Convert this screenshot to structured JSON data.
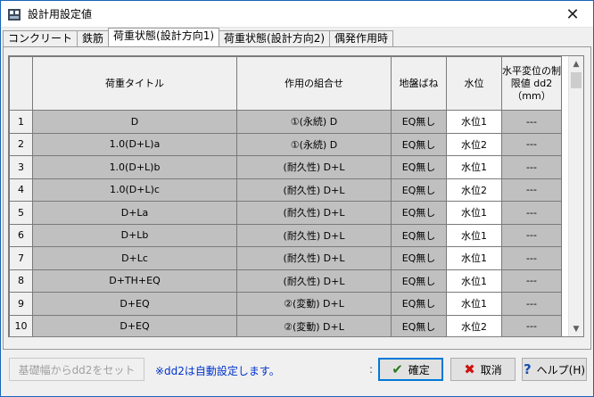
{
  "window": {
    "title": "設計用設定値",
    "close": "✕"
  },
  "tabs": [
    {
      "label": "コンクリート"
    },
    {
      "label": "鉄筋"
    },
    {
      "label": "荷重状態(設計方向1)"
    },
    {
      "label": "荷重状態(設計方向2)"
    },
    {
      "label": "偶発作用時"
    }
  ],
  "table": {
    "headers": [
      "荷重タイトル",
      "作用の組合せ",
      "地盤ばね",
      "水位",
      "水平変位の制限値 dd2（mm）"
    ],
    "rows": [
      {
        "no": "1",
        "title": "D",
        "combo": "①(永続) D",
        "spring": "EQ無し",
        "water": "水位1",
        "limit": "---"
      },
      {
        "no": "2",
        "title": "1.0(D+L)a",
        "combo": "①(永続) D",
        "spring": "EQ無し",
        "water": "水位2",
        "limit": "---"
      },
      {
        "no": "3",
        "title": "1.0(D+L)b",
        "combo": "(耐久性) D+L",
        "spring": "EQ無し",
        "water": "水位1",
        "limit": "---"
      },
      {
        "no": "4",
        "title": "1.0(D+L)c",
        "combo": "(耐久性) D+L",
        "spring": "EQ無し",
        "water": "水位2",
        "limit": "---"
      },
      {
        "no": "5",
        "title": "D+La",
        "combo": "(耐久性) D+L",
        "spring": "EQ無し",
        "water": "水位1",
        "limit": "---"
      },
      {
        "no": "6",
        "title": "D+Lb",
        "combo": "(耐久性) D+L",
        "spring": "EQ無し",
        "water": "水位1",
        "limit": "---"
      },
      {
        "no": "7",
        "title": "D+Lc",
        "combo": "(耐久性) D+L",
        "spring": "EQ無し",
        "water": "水位1",
        "limit": "---"
      },
      {
        "no": "8",
        "title": "D+TH+EQ",
        "combo": "(耐久性) D+L",
        "spring": "EQ無し",
        "water": "水位1",
        "limit": "---"
      },
      {
        "no": "9",
        "title": "D+EQ",
        "combo": "②(変動) D+L",
        "spring": "EQ無し",
        "water": "水位1",
        "limit": "---"
      },
      {
        "no": "10",
        "title": "D+EQ",
        "combo": "②(変動) D+L",
        "spring": "EQ無し",
        "water": "水位2",
        "limit": "---"
      }
    ]
  },
  "footer": {
    "set_dd2_label": "基礎幅からdd2をセット",
    "note": "※dd2は自動設定します。",
    "dot": ":",
    "ok_label": "確定",
    "cancel_label": "取消",
    "help_label": "ヘルプ(H)"
  },
  "colors": {
    "ok_icon": "#2a7a1e",
    "cancel_icon": "#d01010",
    "help_icon": "#1a4fb0",
    "note": "#0033cc"
  }
}
